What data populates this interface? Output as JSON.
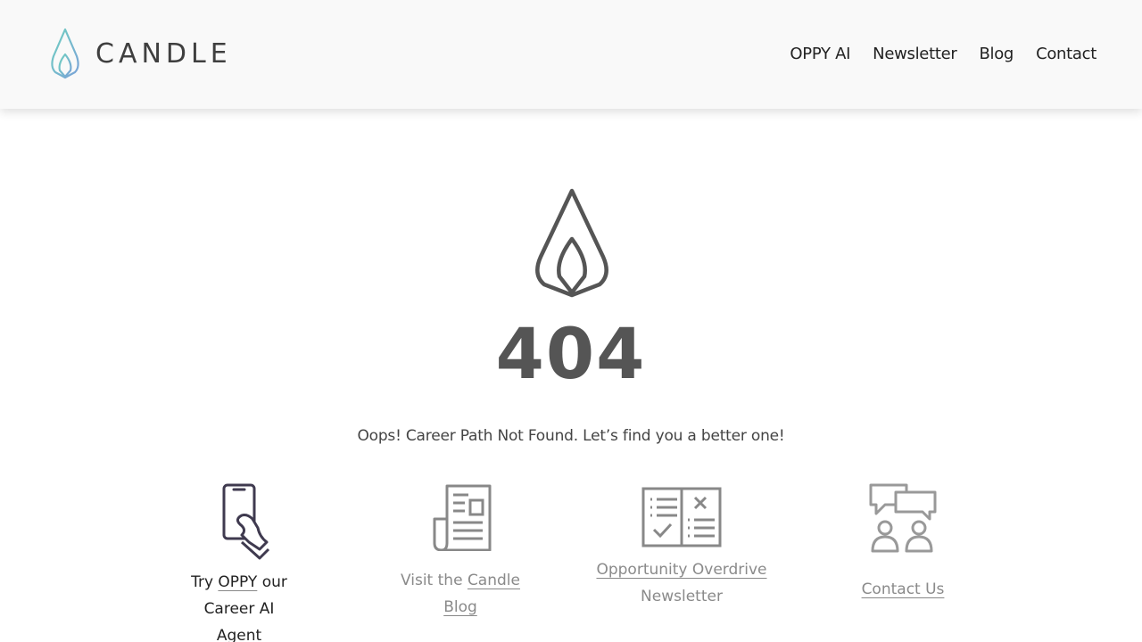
{
  "brand": {
    "name": "CANDLE",
    "colors": {
      "logo_teal": "#6fc9c4",
      "logo_blue": "#7ea6d8",
      "text_dark": "#3f3f3f"
    }
  },
  "nav": {
    "items": [
      "OPPY AI",
      "Newsletter",
      "Blog",
      "Contact"
    ]
  },
  "error": {
    "code": "404",
    "message": "Oops! Career Path Not Found. Let’s find you a better one!",
    "icon": "flame-icon"
  },
  "cards": {
    "oppy": {
      "icon": "phone-hand-icon",
      "prefix": "Try ",
      "link": "OPPY",
      "suffix": " our Career AI Agent"
    },
    "blog": {
      "icon": "newspaper-icon",
      "prefix": "Visit the ",
      "link": "Candle Blog"
    },
    "newsletter": {
      "icon": "checklist-icon",
      "link": "Opportunity Overdrive",
      "suffix": "Newsletter"
    },
    "contact": {
      "icon": "people-chat-icon",
      "link": "Contact Us"
    }
  }
}
